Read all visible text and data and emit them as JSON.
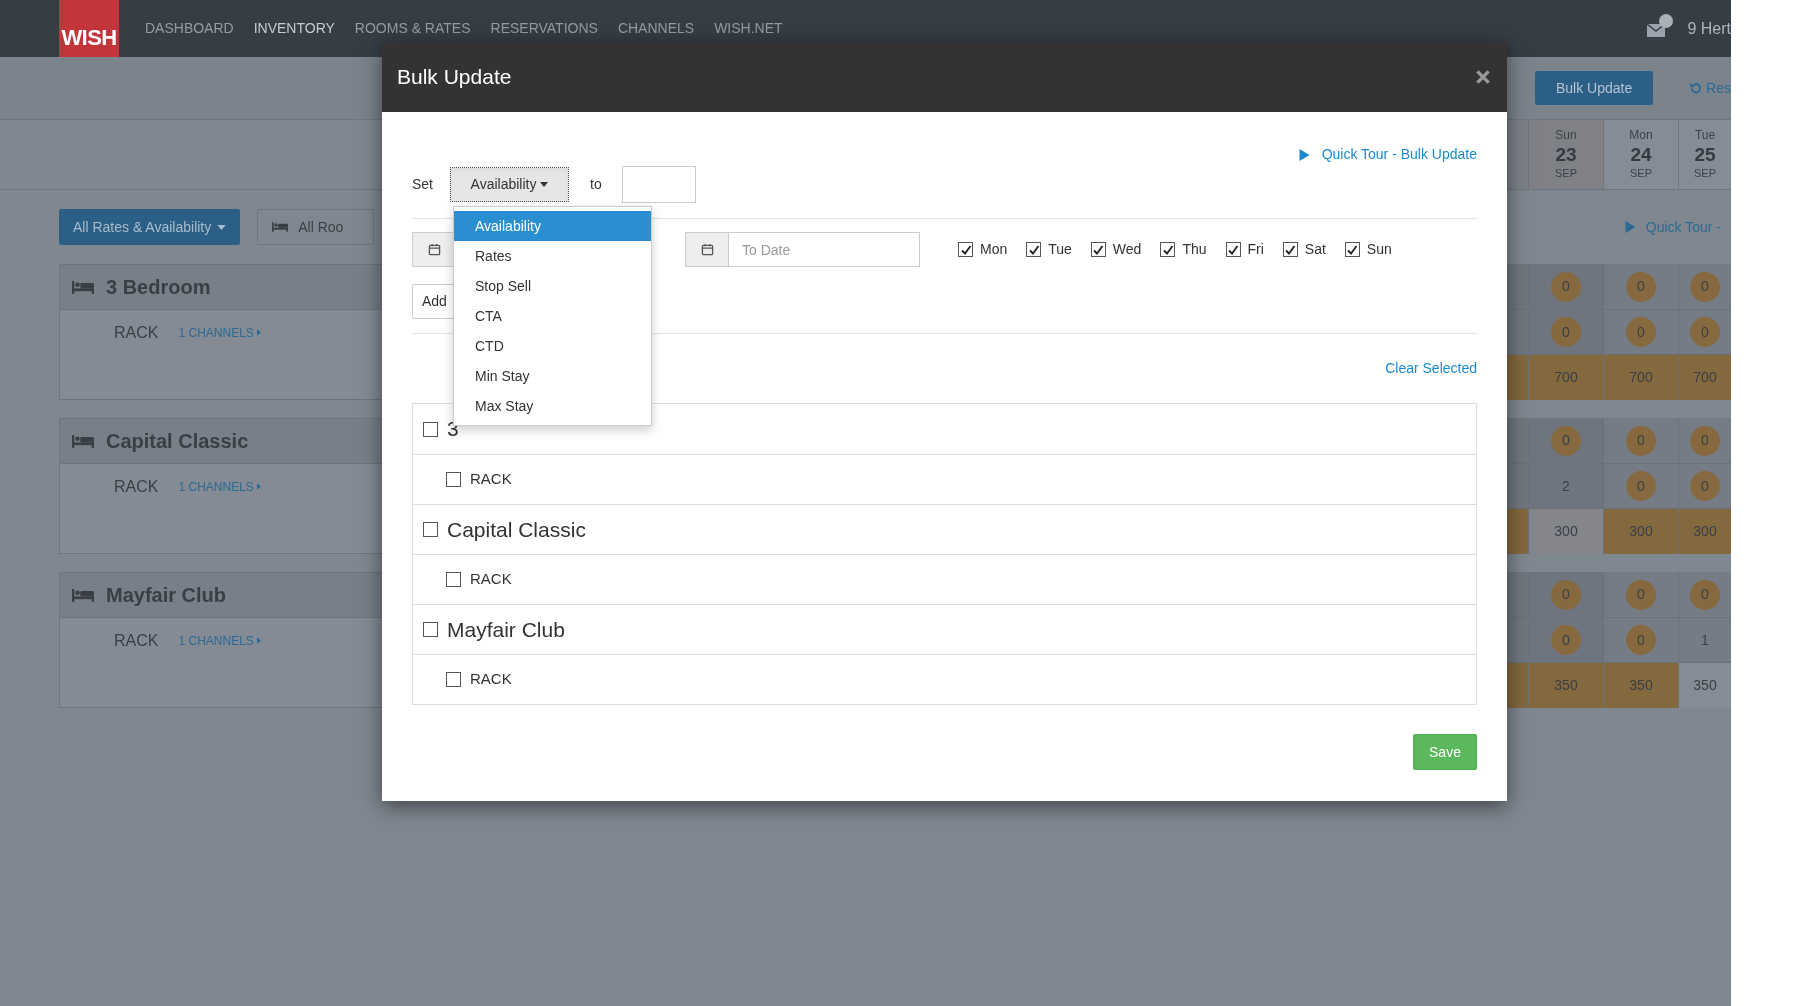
{
  "navbar": {
    "logo": "WISH",
    "items": [
      {
        "label": "DASHBOARD",
        "selected": false
      },
      {
        "label": "INVENTORY",
        "selected": true
      },
      {
        "label": "ROOMS & RATES",
        "selected": false
      },
      {
        "label": "RESERVATIONS",
        "selected": false
      },
      {
        "label": "CHANNELS",
        "selected": false
      },
      {
        "label": "WISH.NET",
        "selected": false
      }
    ],
    "user": "9 Hert"
  },
  "subbar": {
    "bulk_button": "Bulk Update",
    "reset_link": "Res"
  },
  "days": [
    {
      "weekday": "Sun",
      "day": "23",
      "month": "SEP",
      "weekend": true
    },
    {
      "weekday": "Mon",
      "day": "24",
      "month": "SEP",
      "weekend": false
    },
    {
      "weekday": "Tue",
      "day": "25",
      "month": "SEP",
      "weekend": false
    }
  ],
  "toolbar": {
    "rates_filter": "All Rates & Availability",
    "rooms_filter": "All Roo",
    "quick_tour": "Quick Tour -"
  },
  "rooms": [
    {
      "name": "3 Bedroom",
      "rate": "RACK",
      "channels": "1 CHANNELS",
      "availability": [
        {
          "value": "0",
          "kind": "badge"
        },
        {
          "value": "0",
          "kind": "badge"
        },
        {
          "value": "0",
          "kind": "badge"
        }
      ],
      "rate_availability": [
        {
          "value": "0",
          "kind": "badge"
        },
        {
          "value": "0",
          "kind": "badge"
        },
        {
          "value": "0",
          "kind": "badge"
        }
      ],
      "prices": [
        {
          "value": "700",
          "filled": true
        },
        {
          "value": "700",
          "filled": true
        },
        {
          "value": "700",
          "filled": true
        }
      ]
    },
    {
      "name": "Capital Classic",
      "rate": "RACK",
      "channels": "1 CHANNELS",
      "availability": [
        {
          "value": "0",
          "kind": "badge"
        },
        {
          "value": "0",
          "kind": "badge"
        },
        {
          "value": "0",
          "kind": "badge"
        }
      ],
      "rate_availability": [
        {
          "value": "2",
          "kind": "plain"
        },
        {
          "value": "0",
          "kind": "badge"
        },
        {
          "value": "0",
          "kind": "badge"
        }
      ],
      "prices": [
        {
          "value": "300",
          "filled": false
        },
        {
          "value": "300",
          "filled": true
        },
        {
          "value": "300",
          "filled": true
        }
      ]
    },
    {
      "name": "Mayfair Club",
      "rate": "RACK",
      "channels": "1 CHANNELS",
      "availability": [
        {
          "value": "0",
          "kind": "badge"
        },
        {
          "value": "0",
          "kind": "badge"
        },
        {
          "value": "0",
          "kind": "badge"
        }
      ],
      "rate_availability": [
        {
          "value": "0",
          "kind": "badge"
        },
        {
          "value": "0",
          "kind": "badge"
        },
        {
          "value": "1",
          "kind": "plain"
        }
      ],
      "prices": [
        {
          "value": "350",
          "filled": true
        },
        {
          "value": "350",
          "filled": true
        },
        {
          "value": "350",
          "filled": false
        }
      ]
    }
  ],
  "modal": {
    "title": "Bulk Update",
    "set_label": "Set",
    "field_select": "Availability",
    "to_label": "to",
    "quick_tour": "Quick Tour - Bulk Update",
    "to_date": {
      "placeholder": "To Date"
    },
    "weekdays": [
      {
        "label": "Mon",
        "checked": true
      },
      {
        "label": "Tue",
        "checked": true
      },
      {
        "label": "Wed",
        "checked": true
      },
      {
        "label": "Thu",
        "checked": true
      },
      {
        "label": "Fri",
        "checked": true
      },
      {
        "label": "Sat",
        "checked": true
      },
      {
        "label": "Sun",
        "checked": true
      }
    ],
    "add_button": "Add",
    "clear_selected": "Clear Selected",
    "rows": [
      {
        "label": "3",
        "kind": "room",
        "checked": false
      },
      {
        "label": "RACK",
        "kind": "rate",
        "checked": false
      },
      {
        "label": "Capital Classic",
        "kind": "room",
        "checked": false
      },
      {
        "label": "RACK",
        "kind": "rate",
        "checked": false
      },
      {
        "label": "Mayfair Club",
        "kind": "room",
        "checked": false
      },
      {
        "label": "RACK",
        "kind": "rate",
        "checked": false
      }
    ],
    "save_button": "Save",
    "dropdown": [
      {
        "label": "Availability",
        "selected": true
      },
      {
        "label": "Rates",
        "selected": false
      },
      {
        "label": "Stop Sell",
        "selected": false
      },
      {
        "label": "CTA",
        "selected": false
      },
      {
        "label": "CTD",
        "selected": false
      },
      {
        "label": "Min Stay",
        "selected": false
      },
      {
        "label": "Max Stay",
        "selected": false
      }
    ]
  }
}
